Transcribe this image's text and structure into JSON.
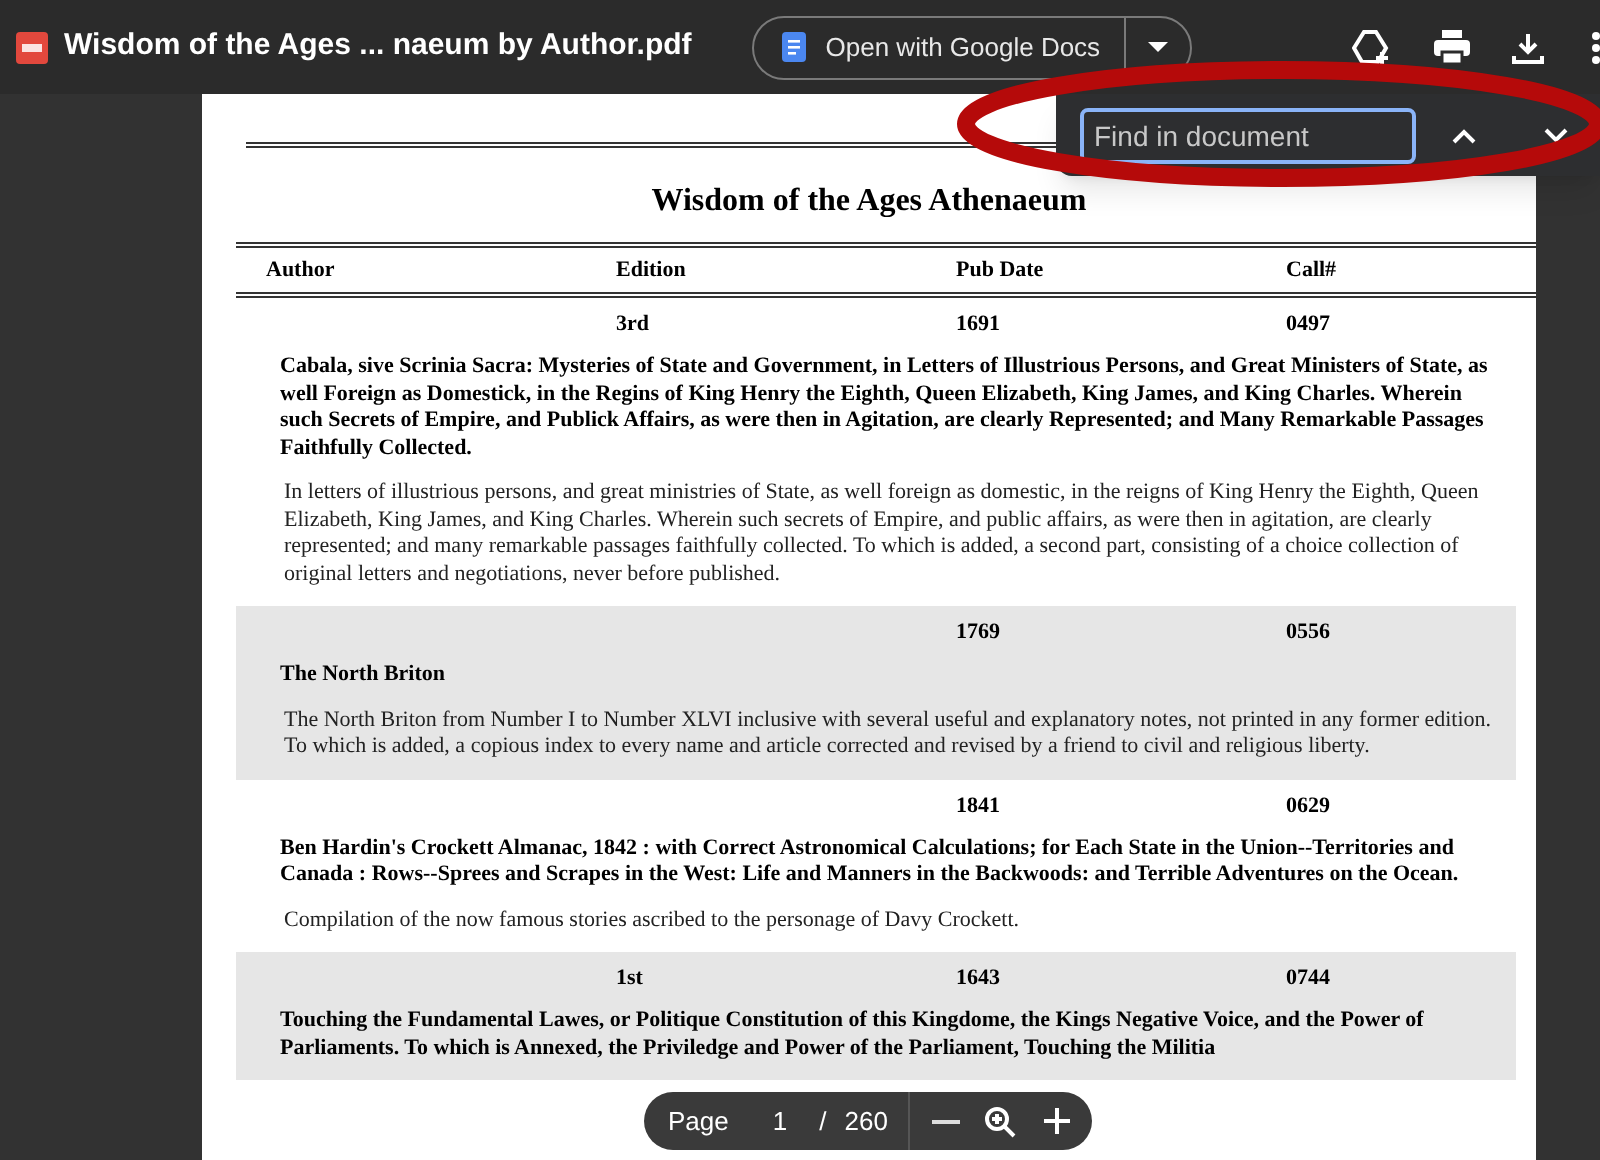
{
  "file": {
    "title": "Wisdom of the Ages ... naeum by Author.pdf"
  },
  "open_with": {
    "label": "Open with Google Docs"
  },
  "find": {
    "placeholder": "Find in document"
  },
  "document": {
    "title": "Wisdom of the Ages Athenaeum",
    "columns": [
      "Author",
      "Edition",
      "Pub Date",
      "Call#"
    ],
    "records": [
      {
        "shaded": false,
        "edition": "3rd",
        "pub_date": "1691",
        "call": "0497",
        "title": "Cabala, sive Scrinia Sacra: Mysteries of State and Government, in Letters of Illustrious Persons, and Great Ministers of State, as well Foreign as Domestick, in the Regins of King Henry the Eighth, Queen Elizabeth, King James, and King Charles. Wherein such Secrets of Empire, and Publick Affairs, as were then in Agitation, are clearly Represented; and Many Remarkable Passages Faithfully Collected.",
        "description": "In letters of illustrious persons, and great ministries of State, as well foreign as domestic, in the reigns of King Henry the Eighth, Queen Elizabeth, King James, and King Charles.  Wherein such secrets of Empire, and public affairs, as were then in agitation, are clearly represented; and many remarkable passages faithfully collected.  To which is added, a second part, consisting of a choice collection of original letters and negotiations, never before published."
      },
      {
        "shaded": true,
        "pub_date": "1769",
        "call": "0556",
        "title": "The North Briton",
        "description": "The North Briton from Number I to Number XLVI inclusive with several useful and explanatory notes, not printed in any former edition.  To which is added, a copious index to every name and article corrected and revised by a friend to civil and religious liberty."
      },
      {
        "shaded": false,
        "pub_date": "1841",
        "call": "0629",
        "title": "Ben Hardin's Crockett Almanac, 1842 : with Correct Astronomical Calculations; for Each State in the Union--Territories and Canada : Rows--Sprees and Scrapes in the West: Life and Manners in the Backwoods: and Terrible Adventures on the Ocean.",
        "description": "Compilation of the now famous stories ascribed to the personage of Davy Crockett."
      },
      {
        "shaded": true,
        "edition": "1st",
        "pub_date": "1643",
        "call": "0744",
        "title": "Touching the Fundamental Lawes, or Politique Constitution of this Kingdome, the Kings Negative Voice, and the Power of Parliaments. To which is Annexed, the Priviledge and Power of the Parliament, Touching the Militia"
      }
    ]
  },
  "page_controls": {
    "label": "Page",
    "page": "1",
    "separator": "/",
    "total": "260"
  }
}
